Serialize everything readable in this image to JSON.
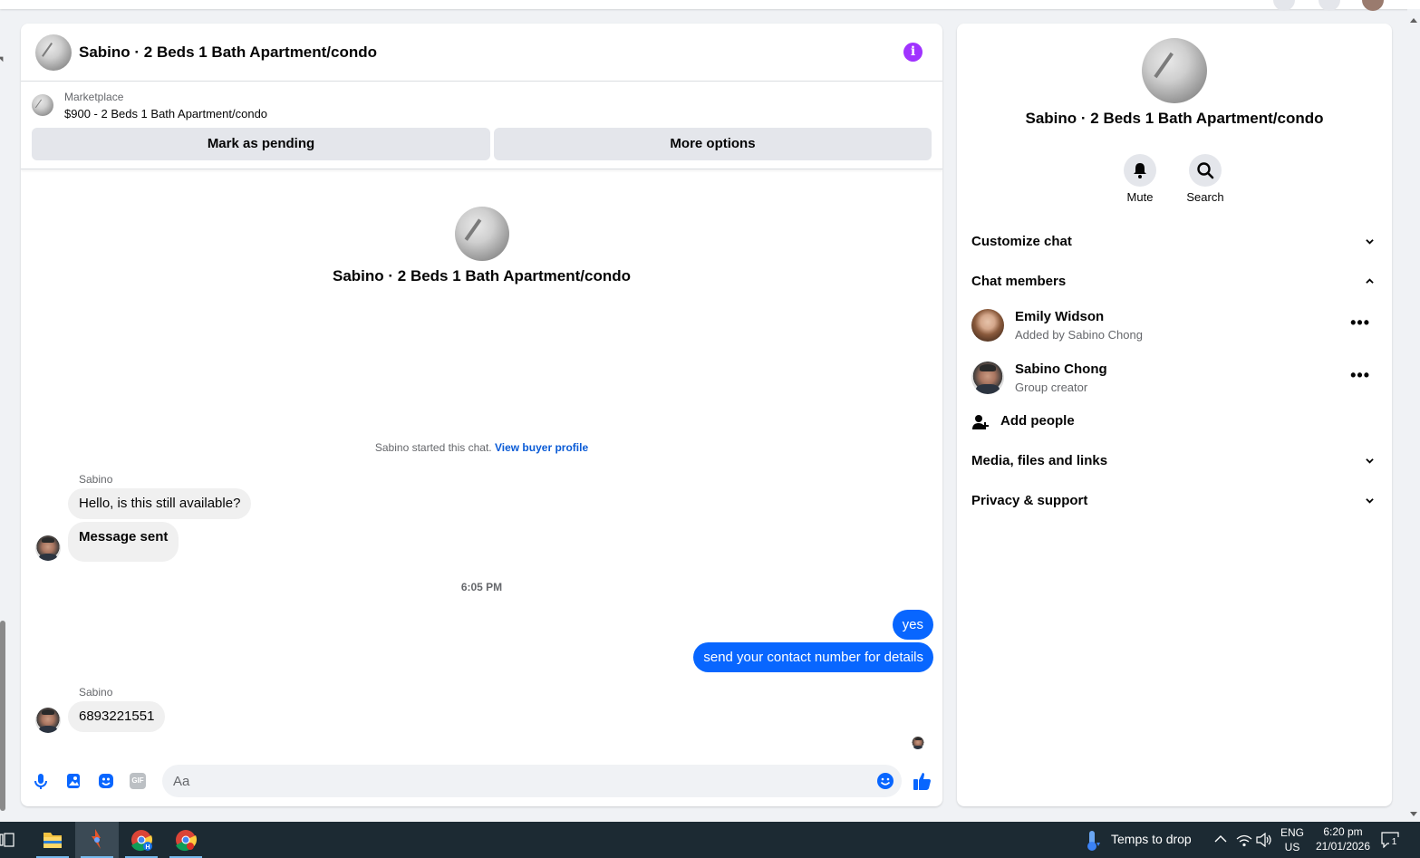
{
  "chat": {
    "title": "Sabino · 2 Beds 1 Bath Apartment/condo",
    "listing": {
      "label": "Marketplace",
      "price_title": "$900 - 2 Beds 1 Bath Apartment/condo",
      "mark_pending": "Mark as pending",
      "more_options": "More options"
    },
    "intro_title": "Sabino · 2 Beds 1 Bath Apartment/condo",
    "started_text": "Sabino started this chat.",
    "view_buyer_profile": "View buyer profile",
    "messages": [
      {
        "sender": "Sabino",
        "text": "Hello, is this still available?"
      },
      {
        "text": "Message sent"
      },
      {
        "timestamp": "6:05 PM"
      },
      {
        "text": "yes"
      },
      {
        "text": "send your contact number for details"
      },
      {
        "sender": "Sabino",
        "text": "6893221551"
      }
    ],
    "composer": {
      "placeholder": "Aa",
      "gif_label": "GIF"
    }
  },
  "info_panel": {
    "title": "Sabino · 2 Beds 1 Bath Apartment/condo",
    "actions": {
      "mute": "Mute",
      "search": "Search"
    },
    "sections": {
      "customize": "Customize chat",
      "members": "Chat members",
      "media": "Media, files and links",
      "privacy": "Privacy & support"
    },
    "members": [
      {
        "name": "Emily Widson",
        "sub": "Added by Sabino Chong"
      },
      {
        "name": "Sabino Chong",
        "sub": "Group creator"
      }
    ],
    "add_people": "Add people"
  },
  "taskbar": {
    "weather": "Temps to drop",
    "lang_top": "ENG",
    "lang_bottom": "US",
    "time": "6:20 pm",
    "date": "21/01/2026",
    "notifications": "1"
  },
  "colors": {
    "accent": "#0866ff",
    "info": "#a033ff",
    "link": "#0a5bd6",
    "taskbar": "#1c2a33"
  }
}
